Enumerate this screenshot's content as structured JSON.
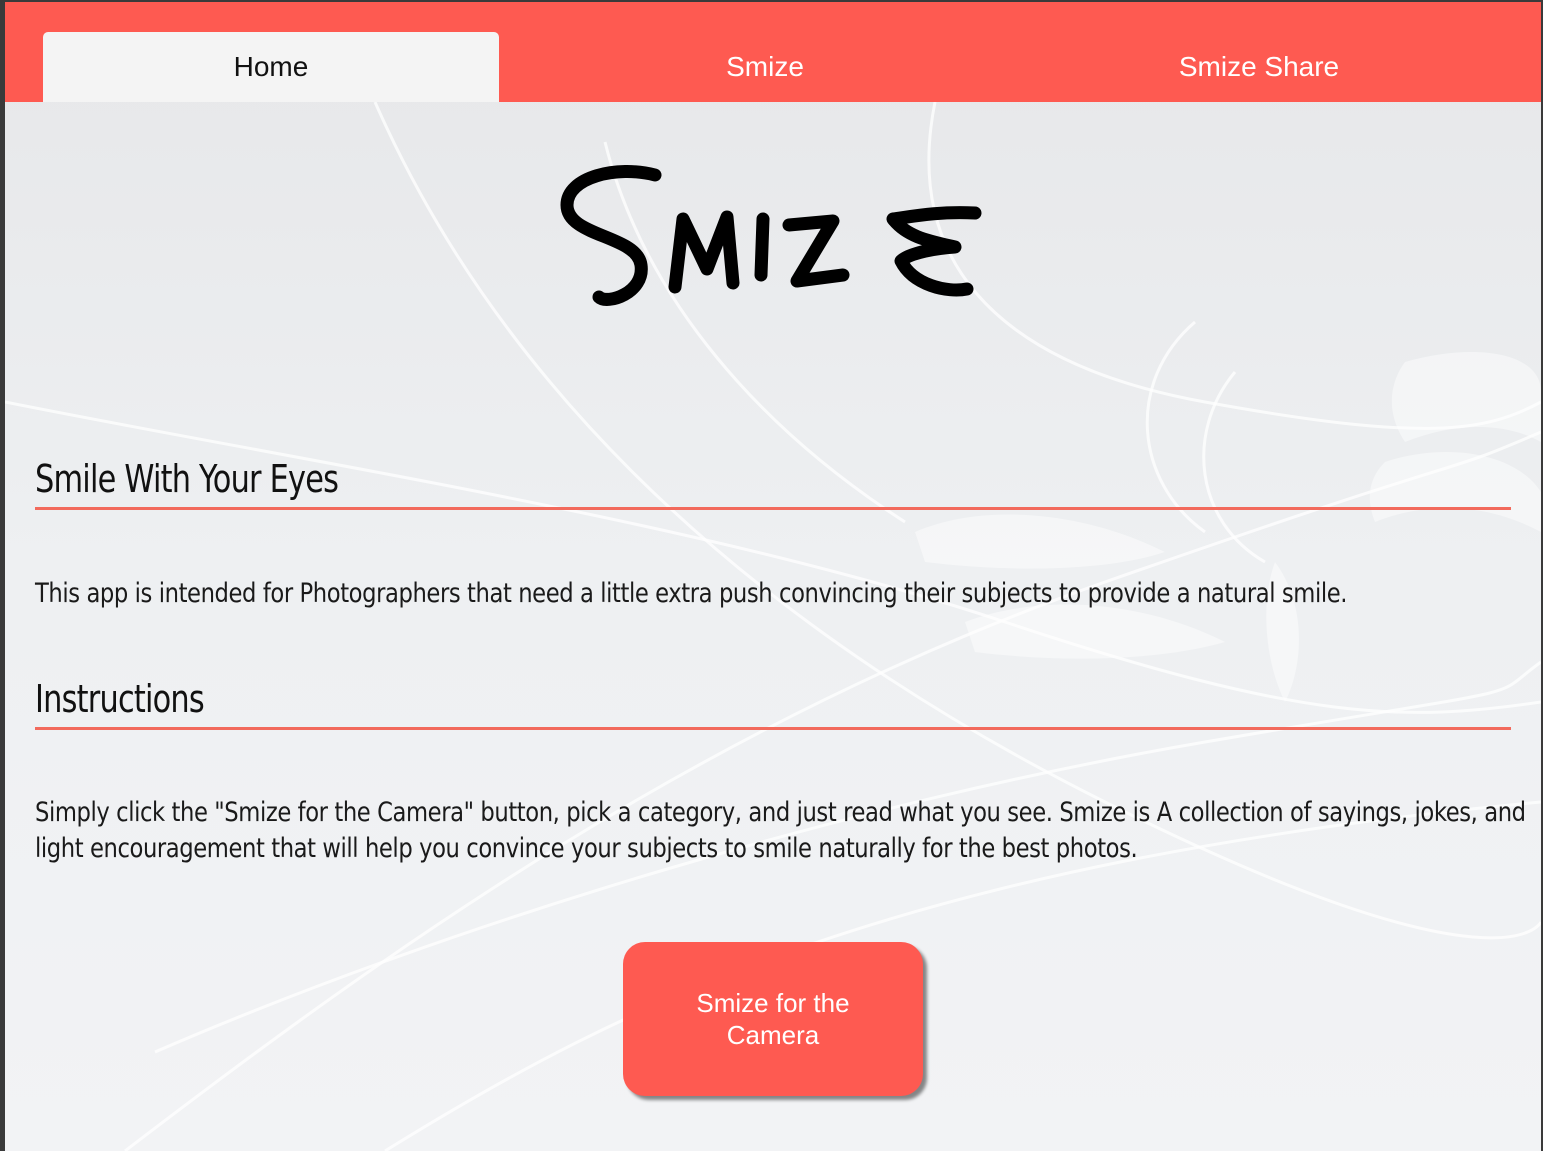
{
  "tabs": [
    {
      "label": "Home",
      "active": true
    },
    {
      "label": "Smize",
      "active": false
    },
    {
      "label": "Smize Share",
      "active": false
    }
  ],
  "logo": {
    "text": "Smize"
  },
  "sections": {
    "tagline": {
      "title": "Smile With Your Eyes",
      "body": "This app is intended for Photographers that need a little extra push convincing their subjects to provide a natural smile."
    },
    "instructions": {
      "title": "Instructions",
      "body_lines": [
        "Simply click the \"Smize for the Camera\" button, pick a category, and just read what you see. Smize is A collection of sayings, jokes, and",
        "light encouragement that will help you convince your subjects to smile naturally for the best photos."
      ]
    }
  },
  "cta": {
    "label": "Smize for the Camera"
  },
  "colors": {
    "accent": "#fe5a51",
    "rule": "#f26a5c",
    "active_tab_bg": "#f4f4f4",
    "background": "#eceef0"
  }
}
